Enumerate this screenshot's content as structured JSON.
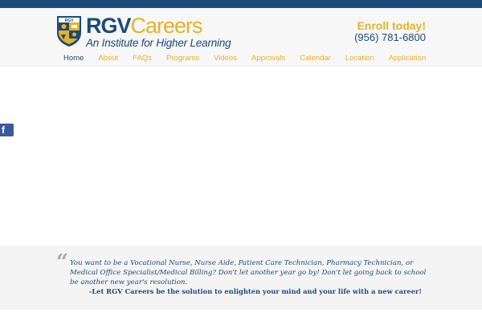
{
  "header": {
    "brand_primary": "RGV",
    "brand_secondary": "Careers",
    "tagline": "An Institute for Higher Learning",
    "enroll_text": "Enroll today!",
    "phone": "(956) 781-6800"
  },
  "nav": {
    "items": [
      "Home",
      "About",
      "FAQs",
      "Programs",
      "Videos",
      "Approvals",
      "Calendar",
      "Location",
      "Application"
    ],
    "active": "Home"
  },
  "social": {
    "facebook_glyph": "f"
  },
  "quote": {
    "mark": "“",
    "text": "You want to be a Vocational Nurse, Nurse Aide, Patient Care Technician, Pharmacy Technician, or Medical Office Specialist/Medical Billing? Don't let another year go by! Don't let going back to school be another new year's resolution.",
    "signature": "-Let RGV Careers be the solution to enlighten your mind and your life with a new career!"
  },
  "colors": {
    "navy": "#1b4a7a",
    "gold": "#e6b227",
    "facebook": "#3b5998"
  },
  "icons": {
    "logo": "rgv-shield-logo-icon",
    "facebook": "facebook-icon",
    "quote": "quote-icon"
  }
}
